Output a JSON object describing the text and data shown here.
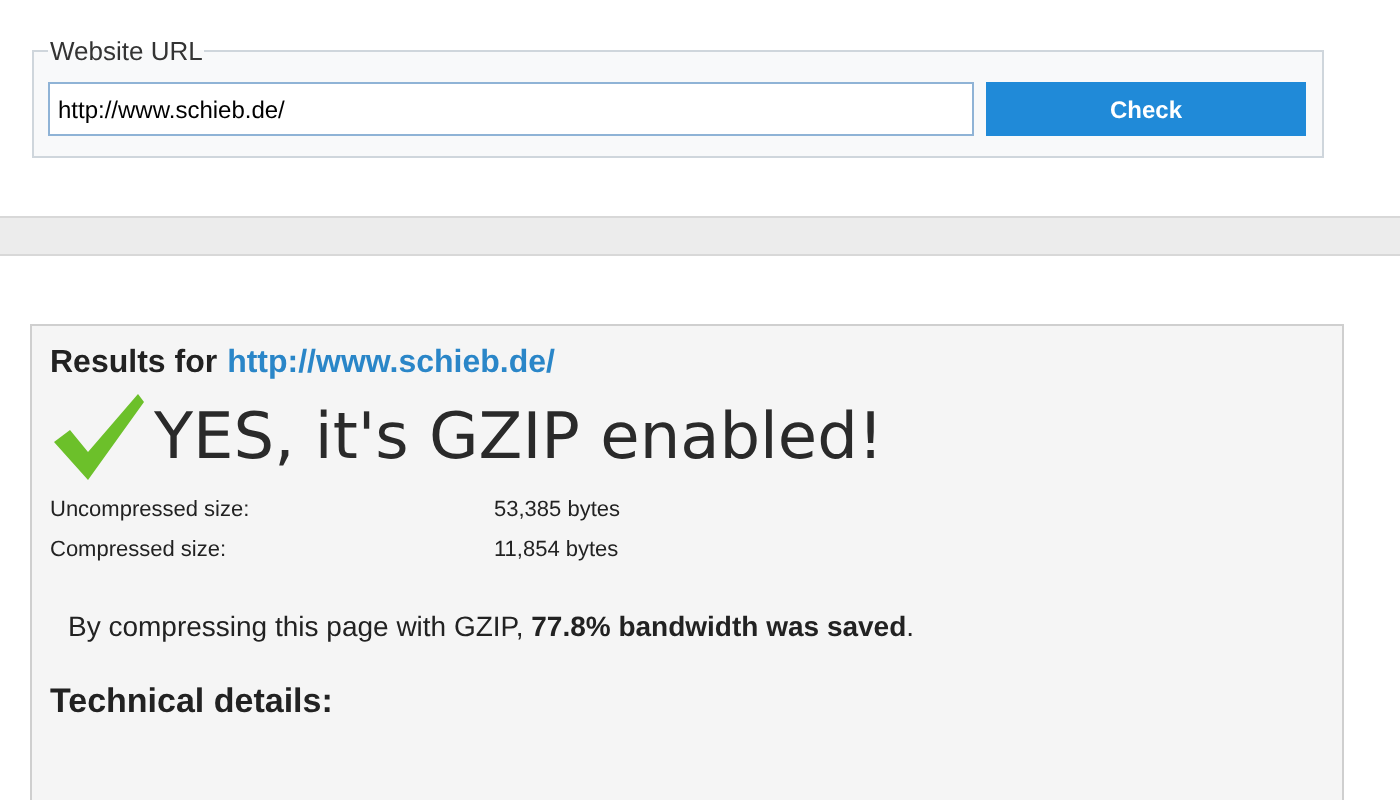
{
  "url_form": {
    "legend": "Website URL",
    "value": "http://www.schieb.de/",
    "button": "Check"
  },
  "results": {
    "heading": "Results for",
    "url": "http://www.schieb.de/",
    "verdict": "YES, it's GZIP enabled!",
    "enabled": true,
    "sizes": [
      {
        "label": "Uncompressed size:",
        "value": "53,385 bytes"
      },
      {
        "label": "Compressed size:",
        "value": "11,854 bytes"
      }
    ],
    "summary": "By compressing this page with GZIP, **77.8% bandwidth was saved**.",
    "details_heading": "Technical details:"
  }
}
